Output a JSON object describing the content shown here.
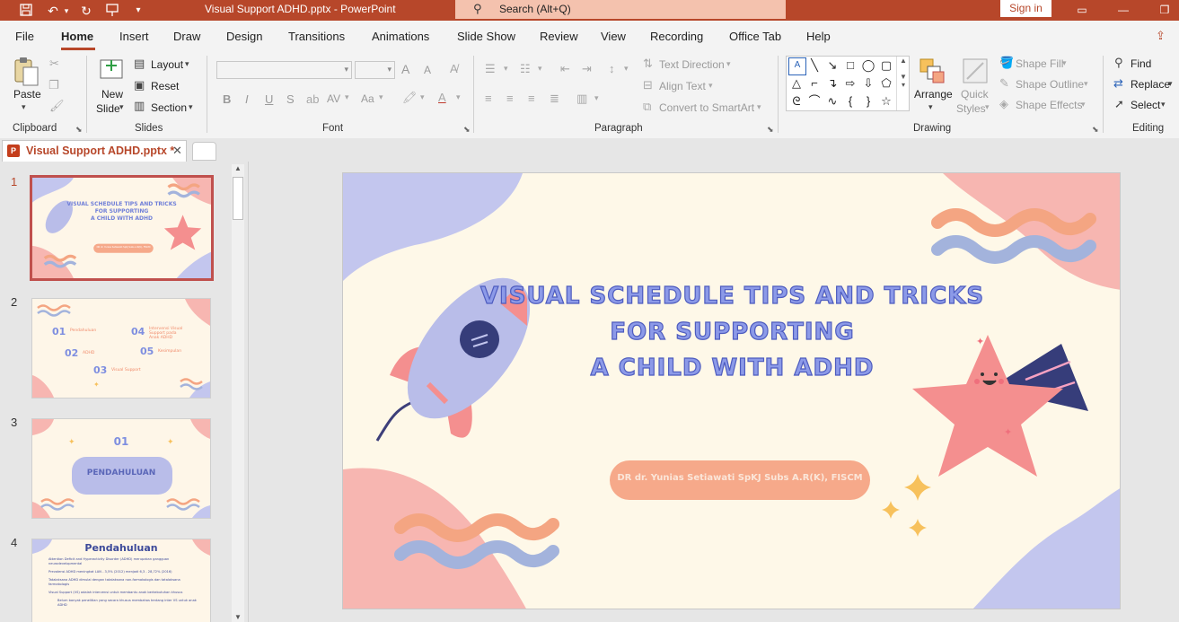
{
  "window": {
    "title": "Visual Support ADHD.pptx  -  PowerPoint",
    "search_placeholder": "Search (Alt+Q)",
    "sign_in": "Sign in"
  },
  "ribbon_tabs": [
    "File",
    "Home",
    "Insert",
    "Draw",
    "Design",
    "Transitions",
    "Animations",
    "Slide Show",
    "Review",
    "View",
    "Recording",
    "Office Tab",
    "Help"
  ],
  "active_tab": "Home",
  "ribbon": {
    "clipboard": {
      "label": "Clipboard",
      "paste": "Paste"
    },
    "slides": {
      "label": "Slides",
      "new_slide_line1": "New",
      "new_slide_line2": "Slide",
      "layout": "Layout",
      "reset": "Reset",
      "section": "Section"
    },
    "font": {
      "label": "Font",
      "bold": "B",
      "italic": "I",
      "underline": "U",
      "strike": "S",
      "grow": "A",
      "shrink": "A",
      "spacing": "AV",
      "case": "Aa"
    },
    "paragraph": {
      "label": "Paragraph",
      "text_direction": "Text Direction",
      "align_text": "Align Text",
      "smartart": "Convert to SmartArt"
    },
    "drawing": {
      "label": "Drawing",
      "arrange": "Arrange",
      "quick_styles_1": "Quick",
      "quick_styles_2": "Styles",
      "shape_fill": "Shape Fill",
      "shape_outline": "Shape Outline",
      "shape_effects": "Shape Effects"
    },
    "editing": {
      "label": "Editing",
      "find": "Find",
      "replace": "Replace",
      "select": "Select"
    }
  },
  "document_tab": {
    "name": "Visual Support ADHD.pptx *"
  },
  "thumbnails": [
    {
      "number": "1",
      "title_l1": "VISUAL SCHEDULE TIPS AND TRICKS",
      "title_l2": "FOR SUPPORTING",
      "title_l3": "A CHILD WITH ADHD",
      "pill": "DR dr. Yunias Setiawati SpKJ Subs A.R(K), FISCM"
    },
    {
      "number": "2",
      "items": [
        {
          "n": "01",
          "t": "Pendahuluan"
        },
        {
          "n": "02",
          "t": "ADHD"
        },
        {
          "n": "03",
          "t": "Visual Support"
        },
        {
          "n": "04",
          "t": "Intervensi Visual Support pada Anak ADHD"
        },
        {
          "n": "05",
          "t": "Kesimpulan"
        }
      ]
    },
    {
      "number": "3",
      "n": "01",
      "label": "PENDAHULUAN"
    },
    {
      "number": "4",
      "title": "Pendahuluan",
      "bullets": [
        "Attention Deficit and Hyperactivity Disorder (ADHD) merupakan gangguan neurodevelopmental",
        "Prevalensi ADHD meningkat LAN - 3,5% (2012) menjadi 6,3 - 28,72% (2016)",
        "Tatalaksana ADHD dimulai dengan tatalaksana non-farmakologis dan tatalaksana farmakologis",
        "Visual Support (VS) adalah intervensi untuk membantu anak berkebutuhan khusus",
        "Belum banyak penelitian yang secara khusus membahas tentang inter VS untuk anak ADHD"
      ]
    }
  ],
  "slide": {
    "title_line1": "VISUAL SCHEDULE TIPS AND TRICKS",
    "title_line2": "FOR SUPPORTING",
    "title_line3": "A CHILD WITH ADHD",
    "presenter": "DR dr. Yunias Setiawati SpKJ Subs A.R(K), FISCM"
  },
  "colors": {
    "accent": "#b7472a",
    "slide_bg": "#fef8e8",
    "blob_pink": "#f7b6b1",
    "blob_lavender": "#c3c6ee",
    "wave_orange": "#f4a582",
    "wave_blue": "#a3b3dc",
    "title_fill": "#8c9ae8",
    "pill": "#f6a98a",
    "sparkle": "#f7c15c"
  }
}
